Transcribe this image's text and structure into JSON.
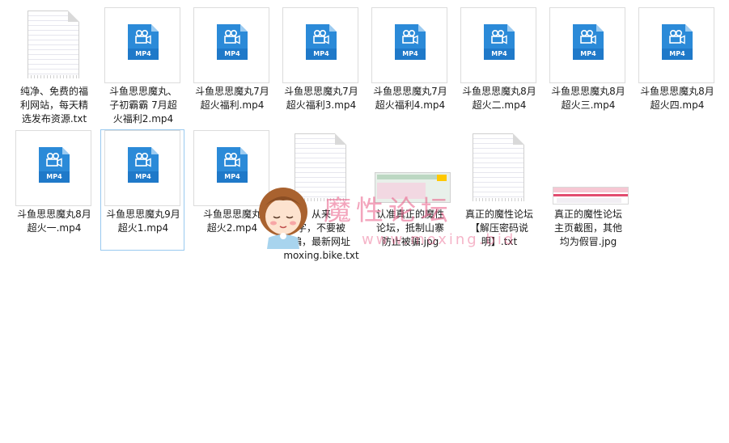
{
  "files": [
    {
      "type": "txt",
      "lines": [
        "纯净、免费的福",
        "利网站，每天精",
        "选发布资源.txt"
      ]
    },
    {
      "type": "mp4",
      "badge": "MP4",
      "lines": [
        "斗鱼思思魔丸、",
        "子初霸霸 7月超",
        "火福利2.mp4"
      ]
    },
    {
      "type": "mp4",
      "badge": "MP4",
      "lines": [
        "斗鱼思思魔丸7月",
        "超火福利.mp4"
      ]
    },
    {
      "type": "mp4",
      "badge": "MP4",
      "lines": [
        "斗鱼思思魔丸7月",
        "超火福利3.mp4"
      ]
    },
    {
      "type": "mp4",
      "badge": "MP4",
      "lines": [
        "斗鱼思思魔丸7月",
        "超火福利4.mp4"
      ]
    },
    {
      "type": "mp4",
      "badge": "MP4",
      "lines": [
        "斗鱼思思魔丸8月",
        "超火二.mp4"
      ]
    },
    {
      "type": "mp4",
      "badge": "MP4",
      "lines": [
        "斗鱼思思魔丸8月",
        "超火三.mp4"
      ]
    },
    {
      "type": "mp4",
      "badge": "MP4",
      "lines": [
        "斗鱼思思魔丸8月",
        "超火四.mp4"
      ]
    },
    {
      "type": "mp4",
      "badge": "MP4",
      "lines": [
        "斗鱼思思魔丸8月",
        "超火一.mp4"
      ]
    },
    {
      "type": "mp4",
      "badge": "MP4",
      "lines": [
        "斗鱼思思魔丸9月",
        "超火1.mp4"
      ],
      "selected": true
    },
    {
      "type": "mp4",
      "badge": "MP4",
      "lines": [
        "斗鱼思思魔丸",
        "超火2.mp4"
      ]
    },
    {
      "type": "txt",
      "lines": [
        "从来",
        "字，不要被",
        "骗，最新网址",
        "moxing.bike.txt"
      ]
    },
    {
      "type": "jpg1",
      "lines": [
        "认准真正的魔性",
        "论坛，抵制山寨",
        "防止被骗.jpg"
      ]
    },
    {
      "type": "txt",
      "lines": [
        "真正的魔性论坛",
        "【解压密码说",
        "明】.txt"
      ]
    },
    {
      "type": "jpg2",
      "lines": [
        "真正的魔性论坛",
        "主页截图，其他",
        "均为假冒.jpg"
      ]
    }
  ],
  "watermark": {
    "text": "魔性论坛",
    "url": "www.moxing.bid"
  }
}
